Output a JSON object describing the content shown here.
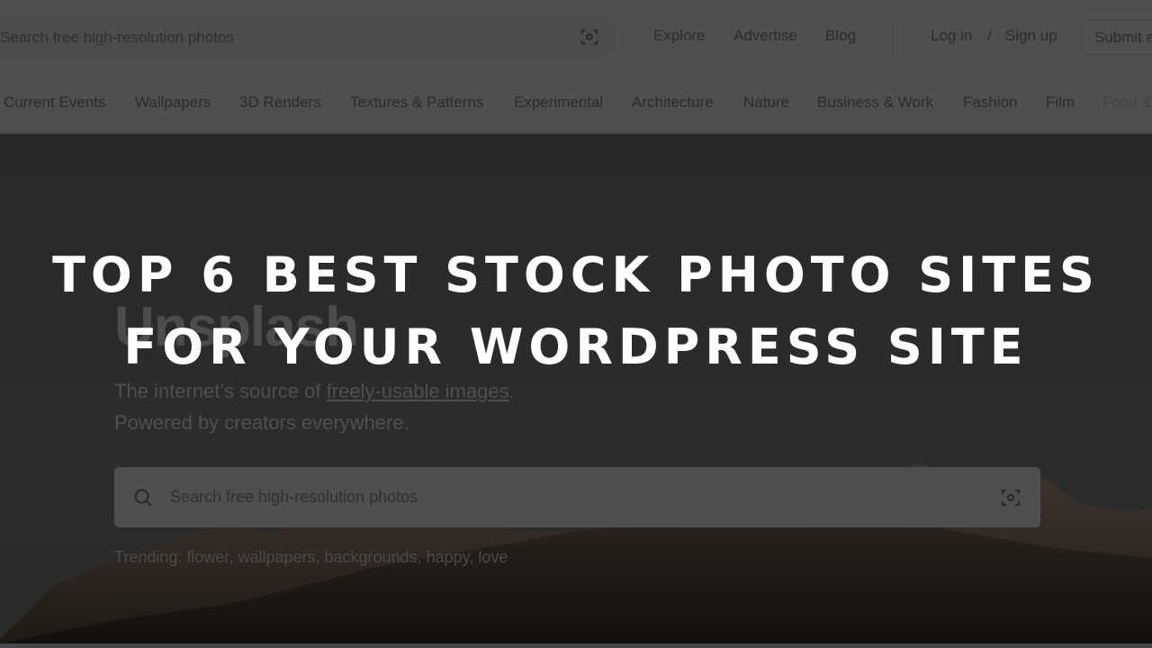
{
  "header": {
    "search_placeholder": "Search free high-resolution photos",
    "visual_search_icon": "visual-search-icon",
    "nav": {
      "explore": "Explore",
      "advertise": "Advertise",
      "blog": "Blog",
      "login": "Log in",
      "slash": "/",
      "signup": "Sign up",
      "submit": "Submit a photo"
    }
  },
  "categories": [
    "Current Events",
    "Wallpapers",
    "3D Renders",
    "Textures & Patterns",
    "Experimental",
    "Architecture",
    "Nature",
    "Business & Work",
    "Fashion",
    "Film",
    "Food & Drink"
  ],
  "hero": {
    "brand": "Unsplash",
    "tagline_prefix": "The internet’s source of ",
    "tagline_link": "freely-usable images",
    "tagline_suffix": ".",
    "tagline_line2": "Powered by creators everywhere.",
    "search_placeholder": "Search free high-resolution photos",
    "search_icon": "search-icon",
    "trending_label": "Trending:",
    "trending": [
      "flower",
      "wallpapers",
      "backgrounds",
      "happy",
      "love"
    ]
  },
  "overlay": {
    "line1": "TOP 6 BEST STOCK PHOTO SITES",
    "line2": "FOR YOUR WORDPRESS SITE",
    "color": "#ffffff"
  },
  "colors": {
    "dim_header": "#4f4f4f",
    "hero_bg": "#2a2b2b",
    "text_dim": "#2b2b2b"
  }
}
